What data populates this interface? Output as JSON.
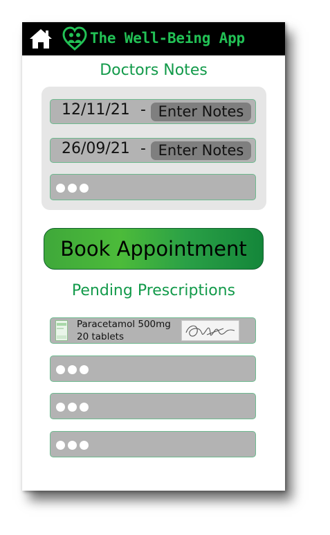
{
  "app": {
    "title": "The Well-Being App",
    "brand_color": "#22c155",
    "icons": {
      "home": "home-icon",
      "logo": "heart-family-icon"
    }
  },
  "doctors_notes": {
    "title": "Doctors Notes",
    "items": [
      {
        "date": "12/11/21",
        "separator": "-",
        "action_label": "Enter Notes"
      },
      {
        "date": "26/09/21",
        "separator": "-",
        "action_label": "Enter Notes"
      }
    ],
    "more_icon": "more-dots-icon"
  },
  "book_appointment": {
    "label": "Book Appointment"
  },
  "pending_prescriptions": {
    "title": "Pending Prescriptions",
    "items": [
      {
        "medication": "Paracetamol 500mg",
        "quantity": "20 tablets",
        "icon": "medicine-box-icon",
        "signature": "signature-image"
      }
    ],
    "more_rows": 3,
    "more_icon": "more-dots-icon"
  }
}
